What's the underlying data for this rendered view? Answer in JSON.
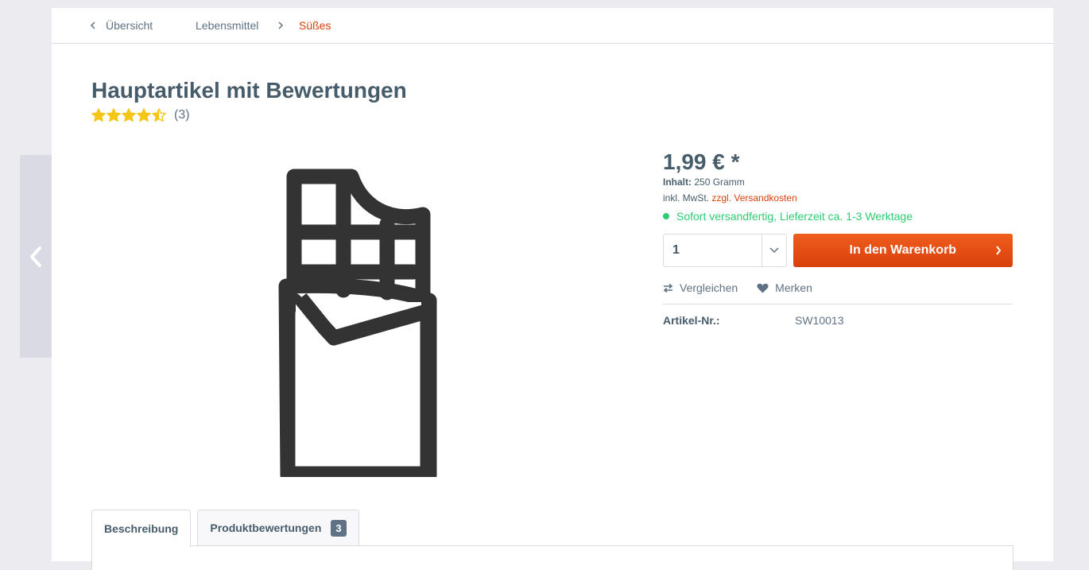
{
  "breadcrumb": {
    "back_label": "Übersicht",
    "items": [
      "Lebensmittel",
      "Süßes"
    ]
  },
  "product": {
    "title": "Hauptartikel mit Bewertungen",
    "rating": 4.5,
    "rating_max": 5,
    "rating_count": "(3)",
    "image_icon": "chocolate-bar-icon"
  },
  "buybox": {
    "price": "1,99 € *",
    "content_label": "Inhalt:",
    "content_value": "250 Gramm",
    "tax_text": "inkl. MwSt.",
    "shipping_link": "zzgl. Versandkosten",
    "delivery": "Sofort versandfertig, Lieferzeit ca. 1-3 Werktage",
    "quantity": "1",
    "buy_label": "In den Warenkorb",
    "compare_label": "Vergleichen",
    "remember_label": "Merken",
    "sku_label": "Artikel-Nr.:",
    "sku_value": "SW10013"
  },
  "tabs": [
    {
      "label": "Beschreibung"
    },
    {
      "label": "Produktbewertungen",
      "badge": "3"
    }
  ],
  "colors": {
    "accent": "#d9400b",
    "text": "#475c6a",
    "delivery_green": "#2ecc71",
    "star": "#f5c518"
  }
}
